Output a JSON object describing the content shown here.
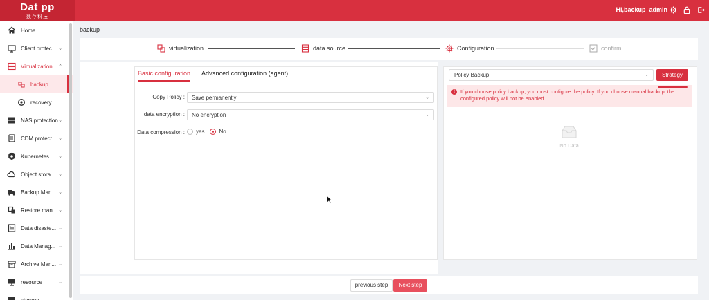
{
  "brand": {
    "name": "Dat  pp",
    "sub": "数存科技"
  },
  "header": {
    "user": "Hi,backup_admin",
    "icons": [
      "gear-icon",
      "lock-icon",
      "logout-icon"
    ]
  },
  "sidebar": {
    "items": [
      {
        "label": "Home",
        "icon": "home-icon"
      },
      {
        "label": "Client protec...",
        "icon": "client-icon"
      },
      {
        "label": "Virtualization...",
        "icon": "virtualization-icon",
        "open": true
      },
      {
        "label": "backup",
        "icon": "backup-icon",
        "sub": true,
        "active": true
      },
      {
        "label": "recovery",
        "icon": "recovery-icon",
        "sub": true
      },
      {
        "label": "NAS protection",
        "icon": "nas-icon"
      },
      {
        "label": "CDM protect...",
        "icon": "cdm-icon"
      },
      {
        "label": "Kubernetes ...",
        "icon": "kubernetes-icon"
      },
      {
        "label": "Object stora...",
        "icon": "cloud-icon"
      },
      {
        "label": "Backup Man...",
        "icon": "truck-icon"
      },
      {
        "label": "Restore man...",
        "icon": "restore-icon"
      },
      {
        "label": "Data disaste...",
        "icon": "disaster-icon"
      },
      {
        "label": "Data Manag...",
        "icon": "chart-icon"
      },
      {
        "label": "Archive Man...",
        "icon": "archive-icon"
      },
      {
        "label": "resource",
        "icon": "resource-icon"
      },
      {
        "label": "storage",
        "icon": "storage-icon"
      }
    ]
  },
  "page": {
    "title": "backup"
  },
  "steps": [
    {
      "label": "virtualization"
    },
    {
      "label": "data source"
    },
    {
      "label": "Configuration"
    },
    {
      "label": "confirm"
    }
  ],
  "tabs": {
    "basic": "Basic configuration",
    "advanced": "Advanced configuration (agent)"
  },
  "form": {
    "copy_policy_label": "Copy Policy :",
    "copy_policy_value": "Save permanently",
    "encryption_label": "data encryption :",
    "encryption_value": "No encryption",
    "compression_label": "Data compression :",
    "compression_yes": "yes",
    "compression_no": "No"
  },
  "policy": {
    "select_value": "Policy Backup",
    "strategy_button": "Strategy",
    "alert": "If you choose policy backup, you must configure the policy. If you choose manual backup, the configured policy will not be enabled.",
    "empty": "No Data"
  },
  "footer": {
    "prev": "previous step",
    "next": "Next step"
  },
  "colors": {
    "accent": "#d8303f",
    "accent_light": "#fde7e8"
  }
}
